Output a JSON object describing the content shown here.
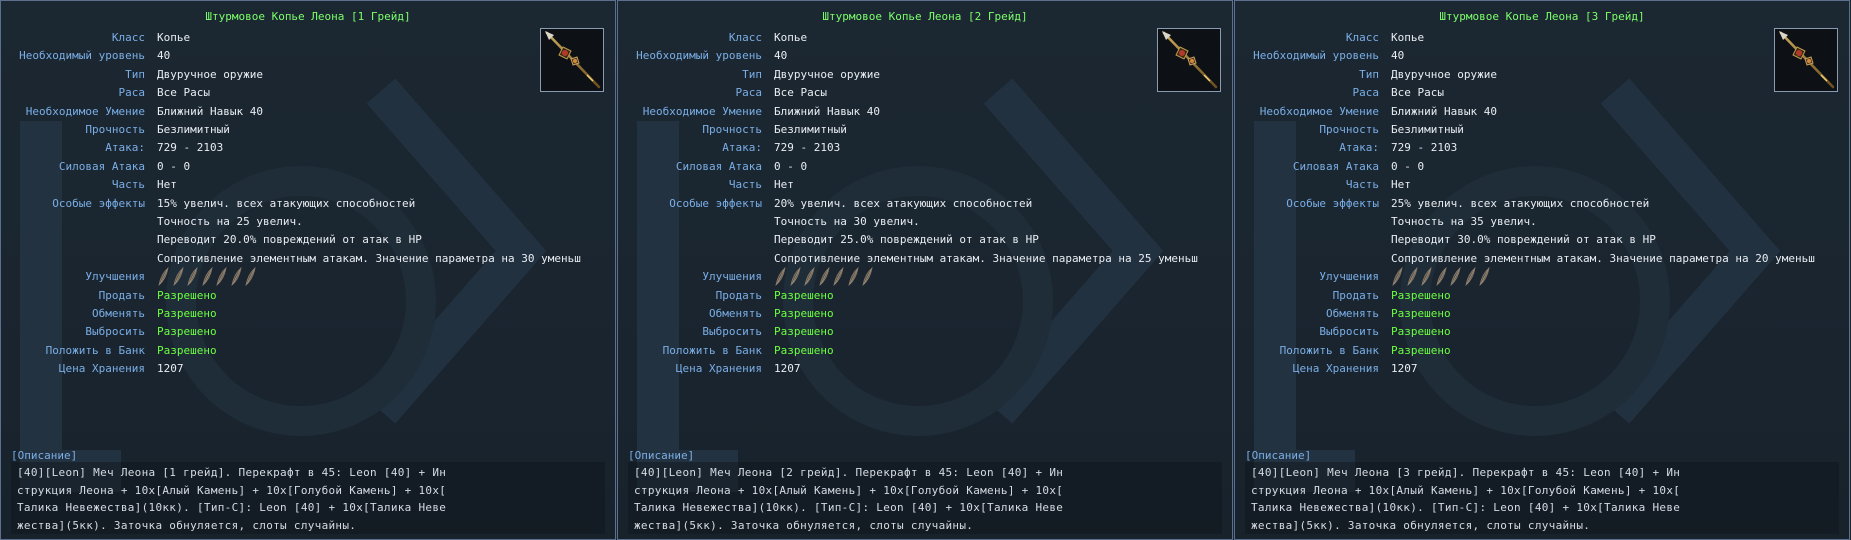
{
  "labels": {
    "class": "Класс",
    "level": "Необходимый уровень",
    "type": "Тип",
    "race": "Раса",
    "skill": "Необходимое Умение",
    "durability": "Прочность",
    "attack": "Атака:",
    "force_attack": "Силовая Атака",
    "part": "Часть",
    "effects": "Особые эффекты",
    "upgrades": "Улучшения",
    "sell": "Продать",
    "trade": "Обменять",
    "drop": "Выбросить",
    "bank": "Положить в Банк",
    "storage_price": "Цена Хранения",
    "description": "[Описание]"
  },
  "icon": "spear-item-icon",
  "upgrade_slots": 7,
  "colors": {
    "title": "#7bff6b",
    "label": "#7aaee6",
    "value": "#e9edf2",
    "allowed": "#6bff3f",
    "panel_border": "#5d6f8e"
  },
  "panels": [
    {
      "title": "Штурмовое Копье Леона [1 Грейд]",
      "class": "Копье",
      "level": "40",
      "type": "Двуручное оружие",
      "race": "Все Расы",
      "skill": "Ближний Навык 40",
      "durability": "Безлимитный",
      "attack": "729 - 2103",
      "force_attack": "0 - 0",
      "part": "Нет",
      "effects": [
        "15% увелич. всех атакующих способностей",
        "Точность на 25 увелич.",
        "Переводит 20.0% повреждений от атак в HP",
        "Сопротивление элементным атакам. Значение параметра на 30 уменьш"
      ],
      "sell": "Разрешено",
      "trade": "Разрешено",
      "drop": "Разрешено",
      "bank": "Разрешено",
      "storage_price": "1207",
      "description_lines": [
        "[40][Leon] Меч Леона [1 грейд]. Перекрафт в 45: Leon [40] + Ин",
        "струкция Леона + 10x[Алый Камень] + 10x[Голубой Камень] + 10x[",
        "Талика Невежества](10кк). [Тип-С]: Leon [40] + 10x[Талика Неве",
        "жества](5кк). Заточка обнуляется, слоты случайны."
      ]
    },
    {
      "title": "Штурмовое Копье Леона [2 Грейд]",
      "class": "Копье",
      "level": "40",
      "type": "Двуручное оружие",
      "race": "Все Расы",
      "skill": "Ближний Навык 40",
      "durability": "Безлимитный",
      "attack": "729 - 2103",
      "force_attack": "0 - 0",
      "part": "Нет",
      "effects": [
        "20% увелич. всех атакующих способностей",
        "Точность на 30 увелич.",
        "Переводит 25.0% повреждений от атак в HP",
        "Сопротивление элементным атакам. Значение параметра на 25 уменьш"
      ],
      "sell": "Разрешено",
      "trade": "Разрешено",
      "drop": "Разрешено",
      "bank": "Разрешено",
      "storage_price": "1207",
      "description_lines": [
        "[40][Leon] Меч Леона [2 грейд]. Перекрафт в 45: Leon [40] + Ин",
        "струкция Леона + 10x[Алый Камень] + 10x[Голубой Камень] + 10x[",
        "Талика Невежества](10кк). [Тип-С]: Leon [40] + 10x[Талика Неве",
        "жества](5кк). Заточка обнуляется, слоты случайны."
      ]
    },
    {
      "title": "Штурмовое Копье Леона [3 Грейд]",
      "class": "Копье",
      "level": "40",
      "type": "Двуручное оружие",
      "race": "Все Расы",
      "skill": "Ближний Навык 40",
      "durability": "Безлимитный",
      "attack": "729 - 2103",
      "force_attack": "0 - 0",
      "part": "Нет",
      "effects": [
        "25% увелич. всех атакующих способностей",
        "Точность на 35 увелич.",
        "Переводит 30.0% повреждений от атак в HP",
        "Сопротивление элементным атакам. Значение параметра на 20 уменьш"
      ],
      "sell": "Разрешено",
      "trade": "Разрешено",
      "drop": "Разрешено",
      "bank": "Разрешено",
      "storage_price": "1207",
      "description_lines": [
        "[40][Leon] Меч Леона [3 грейд]. Перекрафт в 45: Leon [40] + Ин",
        "струкция Леона + 10x[Алый Камень] + 10x[Голубой Камень] + 10x[",
        "Талика Невежества](10кк). [Тип-С]: Leon [40] + 10x[Талика Неве",
        "жества](5кк). Заточка обнуляется, слоты случайны."
      ]
    }
  ]
}
